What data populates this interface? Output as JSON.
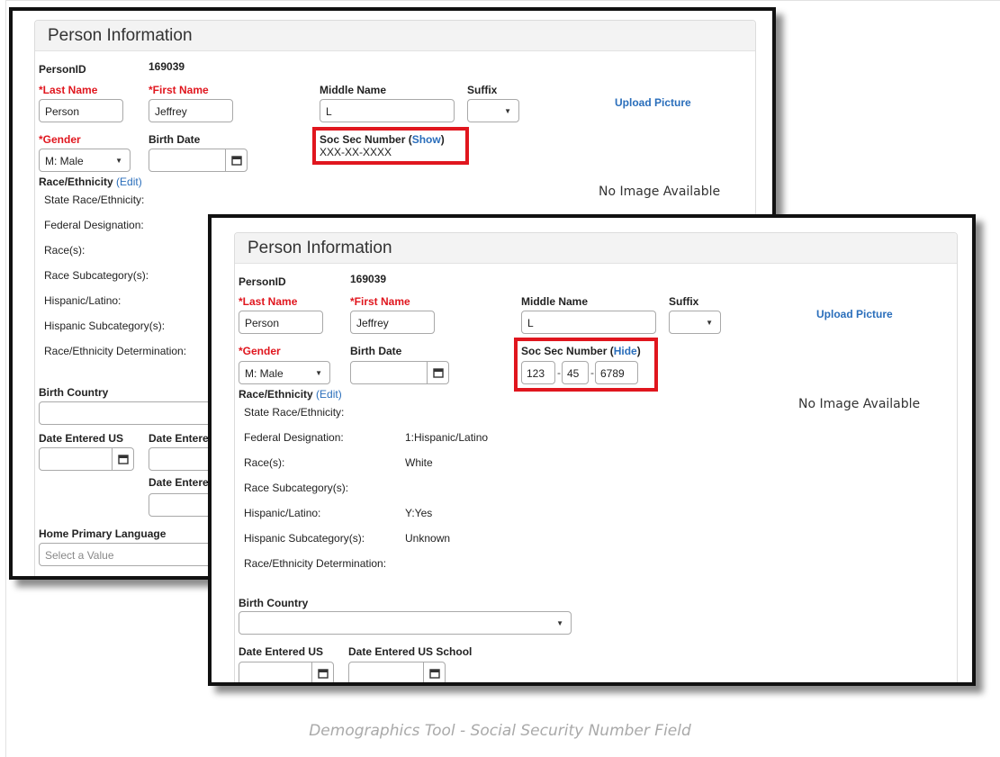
{
  "panel_title": "Person Information",
  "labels": {
    "person_id": "PersonID",
    "last_name": "*Last Name",
    "first_name": "*First Name",
    "middle_name": "Middle Name",
    "suffix": "Suffix",
    "gender": "*Gender",
    "birth_date": "Birth Date",
    "ssn": "Soc Sec Number",
    "race_ethnicity": "Race/Ethnicity",
    "edit": "(Edit)",
    "state_race": "State Race/Ethnicity:",
    "federal": "Federal Designation:",
    "races": "Race(s):",
    "race_sub": "Race Subcategory(s):",
    "hispanic": "Hispanic/Latino:",
    "hispanic_sub": "Hispanic Subcategory(s):",
    "determination": "Race/Ethnicity Determination:",
    "birth_country": "Birth Country",
    "date_entered_us": "Date Entered US",
    "date_entered_us_school": "Date Entered US School",
    "date_entered_partial": "Date Entere",
    "home_language": "Home Primary Language"
  },
  "values": {
    "person_id": "169039",
    "last_name": "Person",
    "first_name": "Jeffrey",
    "middle_name": "L",
    "gender": "M: Male",
    "upload_picture": "Upload Picture",
    "no_image": "No Image Available",
    "home_language_placeholder": "Select a Value"
  },
  "shot1": {
    "ssn_toggle_open": "(",
    "ssn_toggle": "Show",
    "ssn_toggle_close": ")",
    "ssn_masked": "XXX-XX-XXXX"
  },
  "shot2": {
    "ssn_toggle_open": "(",
    "ssn_toggle": "Hide",
    "ssn_toggle_close": ")",
    "ssn_part1": "123",
    "ssn_part2": "45",
    "ssn_part3": "6789",
    "federal": "1:Hispanic/Latino",
    "races": "White",
    "hispanic": "Y:Yes",
    "hispanic_sub": "Unknown"
  },
  "icons": {
    "calendar": "calendar-icon",
    "dropdown": "chevron-down-icon"
  },
  "colors": {
    "required": "#e0161e",
    "link": "#2a6ebb",
    "highlight": "#e0161e"
  },
  "caption": "Demographics Tool - Social Security Number Field"
}
